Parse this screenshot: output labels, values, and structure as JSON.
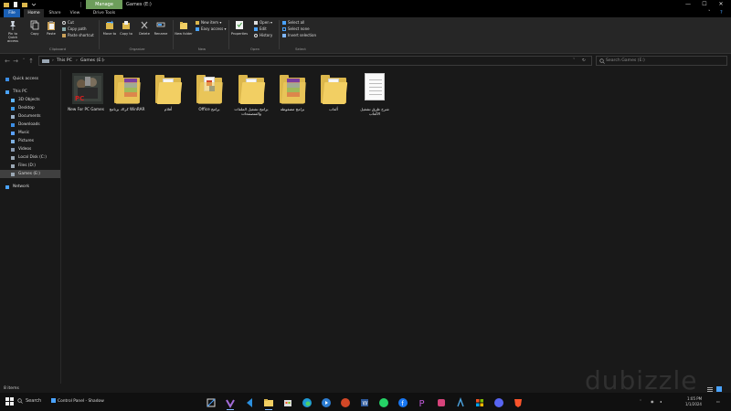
{
  "titlebar": {
    "manage_tab": "Manage",
    "title": "Games (E:)"
  },
  "ribbon_tabs": {
    "file": "File",
    "home": "Home",
    "share": "Share",
    "view": "View",
    "drive_tools": "Drive Tools"
  },
  "ribbon": {
    "pin": "Pin to Quick access",
    "copy": "Copy",
    "paste": "Paste",
    "cut": "Cut",
    "copy_path": "Copy path",
    "paste_shortcut": "Paste shortcut",
    "clipboard_group": "Clipboard",
    "move_to": "Move to",
    "copy_to": "Copy to",
    "delete": "Delete",
    "rename": "Rename",
    "organize_group": "Organize",
    "new_folder": "New folder",
    "new_item": "New item",
    "easy_access": "Easy access",
    "new_group": "New",
    "properties": "Properties",
    "open": "Open",
    "edit": "Edit",
    "history": "History",
    "open_group": "Open",
    "select_all": "Select all",
    "select_none": "Select none",
    "invert_selection": "Invert selection",
    "select_group": "Select"
  },
  "address": {
    "crumbs": [
      "This PC",
      "Games (E:)"
    ],
    "search_placeholder": "Search Games (E:)"
  },
  "nav": {
    "items": [
      {
        "label": "Quick access",
        "icon": "star-icon",
        "color": "#3b8ee6"
      },
      {
        "label": "This PC",
        "icon": "pc-icon",
        "color": "#4aa3ff"
      },
      {
        "label": "3D Objects",
        "icon": "cube-icon",
        "color": "#60b5ff"
      },
      {
        "label": "Desktop",
        "icon": "desktop-icon",
        "color": "#3f9ae8"
      },
      {
        "label": "Documents",
        "icon": "documents-icon",
        "color": "#9ab0c8"
      },
      {
        "label": "Downloads",
        "icon": "download-icon",
        "color": "#3b8ee6"
      },
      {
        "label": "Music",
        "icon": "music-icon",
        "color": "#5aa0ff"
      },
      {
        "label": "Pictures",
        "icon": "pictures-icon",
        "color": "#7fb0e0"
      },
      {
        "label": "Videos",
        "icon": "videos-icon",
        "color": "#8a9ab0"
      },
      {
        "label": "Local Disk (C:)",
        "icon": "drive-icon",
        "color": "#9aa7b4"
      },
      {
        "label": "Files (D:)",
        "icon": "drive-icon",
        "color": "#9aa7b4"
      },
      {
        "label": "Games (E:)",
        "icon": "drive-icon",
        "color": "#9aa7b4"
      },
      {
        "label": "Network",
        "icon": "network-icon",
        "color": "#4aa3ff"
      }
    ]
  },
  "files": [
    {
      "label": "New For PC Games",
      "kind": "game"
    },
    {
      "label": "WinRAR كراك برنامج",
      "kind": "rar-folder"
    },
    {
      "label": "أفلام",
      "kind": "folder"
    },
    {
      "label": "برامج Office",
      "kind": "office-folder"
    },
    {
      "label": "برامج تشغيل الملفات والمتصفحات",
      "kind": "folder"
    },
    {
      "label": "برامج مضغوطة",
      "kind": "rar-folder"
    },
    {
      "label": "ألعاب",
      "kind": "folder"
    },
    {
      "label": "شرح طرق تشغيل الألعاب",
      "kind": "document"
    }
  ],
  "status": {
    "items_count": "8 items"
  },
  "taskbar": {
    "search_label": "Search",
    "active_task": "Control Panel - Shadow",
    "time": "1:05 PM",
    "date": "1/1/2024"
  }
}
